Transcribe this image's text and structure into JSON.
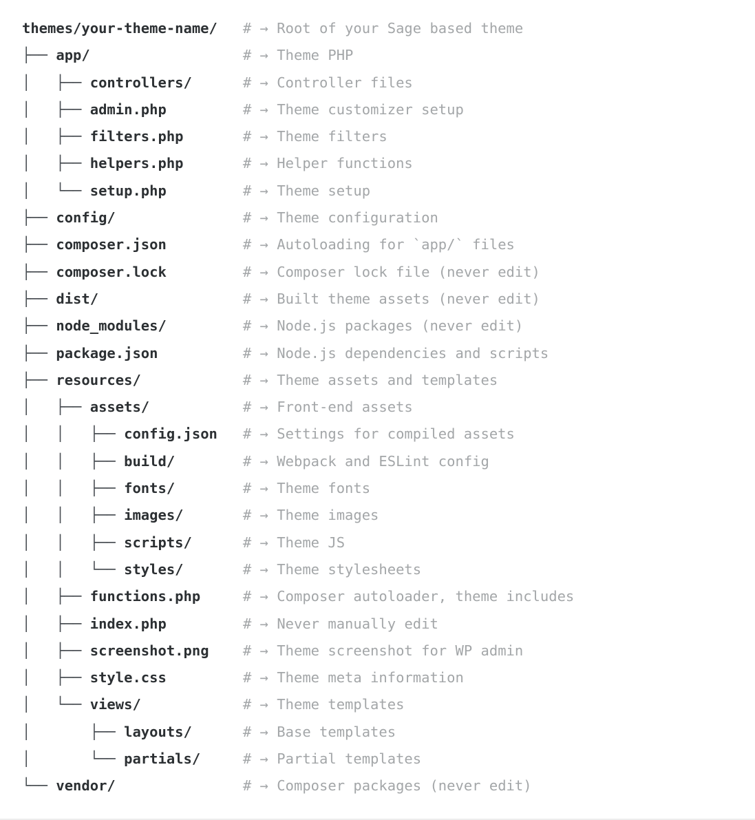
{
  "block": {
    "type": "code-block",
    "language": "shell",
    "comment_prefix": "#",
    "comment_arrow": "→",
    "colors": {
      "background": "#ffffff",
      "name": "#2c3033",
      "tree_glyph": "#4a4f54",
      "comment": "#a3a6a8",
      "bottom_rule": "#ededed"
    },
    "glyphs": {
      "tee": "├──",
      "elbow": "└──",
      "pipe": "│"
    },
    "comment_column": 26
  },
  "tree": {
    "lines": [
      {
        "prefix": "",
        "name": "themes/your-theme-name/",
        "comment": "Root of your Sage based theme",
        "depth": 0,
        "kind": "directory"
      },
      {
        "prefix": "├── ",
        "name": "app/",
        "comment": "Theme PHP",
        "depth": 1,
        "kind": "directory"
      },
      {
        "prefix": "│   ├── ",
        "name": "controllers/",
        "comment": "Controller files",
        "depth": 2,
        "kind": "directory"
      },
      {
        "prefix": "│   ├── ",
        "name": "admin.php",
        "comment": "Theme customizer setup",
        "depth": 2,
        "kind": "file"
      },
      {
        "prefix": "│   ├── ",
        "name": "filters.php",
        "comment": "Theme filters",
        "depth": 2,
        "kind": "file"
      },
      {
        "prefix": "│   ├── ",
        "name": "helpers.php",
        "comment": "Helper functions",
        "depth": 2,
        "kind": "file"
      },
      {
        "prefix": "│   └── ",
        "name": "setup.php",
        "comment": "Theme setup",
        "depth": 2,
        "kind": "file"
      },
      {
        "prefix": "├── ",
        "name": "config/",
        "comment": "Theme configuration",
        "depth": 1,
        "kind": "directory"
      },
      {
        "prefix": "├── ",
        "name": "composer.json",
        "comment": "Autoloading for `app/` files",
        "depth": 1,
        "kind": "file"
      },
      {
        "prefix": "├── ",
        "name": "composer.lock",
        "comment": "Composer lock file (never edit)",
        "depth": 1,
        "kind": "file"
      },
      {
        "prefix": "├── ",
        "name": "dist/",
        "comment": "Built theme assets (never edit)",
        "depth": 1,
        "kind": "directory"
      },
      {
        "prefix": "├── ",
        "name": "node_modules/",
        "comment": "Node.js packages (never edit)",
        "depth": 1,
        "kind": "directory"
      },
      {
        "prefix": "├── ",
        "name": "package.json",
        "comment": "Node.js dependencies and scripts",
        "depth": 1,
        "kind": "file"
      },
      {
        "prefix": "├── ",
        "name": "resources/",
        "comment": "Theme assets and templates",
        "depth": 1,
        "kind": "directory"
      },
      {
        "prefix": "│   ├── ",
        "name": "assets/",
        "comment": "Front-end assets",
        "depth": 2,
        "kind": "directory"
      },
      {
        "prefix": "│   │   ├── ",
        "name": "config.json",
        "comment": "Settings for compiled assets",
        "depth": 3,
        "kind": "file"
      },
      {
        "prefix": "│   │   ├── ",
        "name": "build/",
        "comment": "Webpack and ESLint config",
        "depth": 3,
        "kind": "directory"
      },
      {
        "prefix": "│   │   ├── ",
        "name": "fonts/",
        "comment": "Theme fonts",
        "depth": 3,
        "kind": "directory"
      },
      {
        "prefix": "│   │   ├── ",
        "name": "images/",
        "comment": "Theme images",
        "depth": 3,
        "kind": "directory"
      },
      {
        "prefix": "│   │   ├── ",
        "name": "scripts/",
        "comment": "Theme JS",
        "depth": 3,
        "kind": "directory"
      },
      {
        "prefix": "│   │   └── ",
        "name": "styles/",
        "comment": "Theme stylesheets",
        "depth": 3,
        "kind": "directory"
      },
      {
        "prefix": "│   ├── ",
        "name": "functions.php",
        "comment": "Composer autoloader, theme includes",
        "depth": 2,
        "kind": "file"
      },
      {
        "prefix": "│   ├── ",
        "name": "index.php",
        "comment": "Never manually edit",
        "depth": 2,
        "kind": "file"
      },
      {
        "prefix": "│   ├── ",
        "name": "screenshot.png",
        "comment": "Theme screenshot for WP admin",
        "depth": 2,
        "kind": "file"
      },
      {
        "prefix": "│   ├── ",
        "name": "style.css",
        "comment": "Theme meta information",
        "depth": 2,
        "kind": "file"
      },
      {
        "prefix": "│   └── ",
        "name": "views/",
        "comment": "Theme templates",
        "depth": 2,
        "kind": "directory"
      },
      {
        "prefix": "│       ├── ",
        "name": "layouts/",
        "comment": "Base templates",
        "depth": 3,
        "kind": "directory"
      },
      {
        "prefix": "│       └── ",
        "name": "partials/",
        "comment": "Partial templates",
        "depth": 3,
        "kind": "directory"
      },
      {
        "prefix": "└── ",
        "name": "vendor/",
        "comment": "Composer packages (never edit)",
        "depth": 1,
        "kind": "directory"
      }
    ]
  }
}
